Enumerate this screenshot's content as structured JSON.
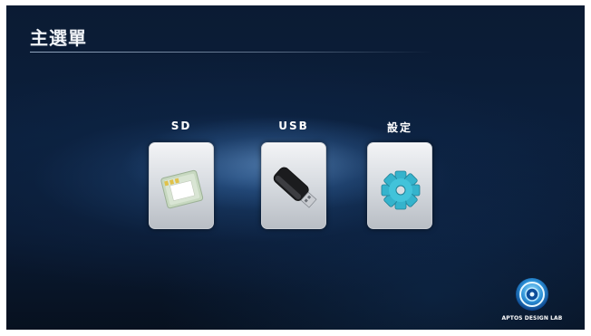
{
  "header": {
    "title": "主選單"
  },
  "menu": {
    "items": [
      {
        "label": "SD",
        "icon": "sd-card-icon"
      },
      {
        "label": "USB",
        "icon": "usb-drive-icon"
      },
      {
        "label": "設定",
        "icon": "gear-icon"
      }
    ]
  },
  "brand": {
    "name": "APTOS DESIGN LAB",
    "logo": "aptos-logo-icon"
  },
  "colors": {
    "background": "#0b1f3c",
    "tile": "#d9dde2",
    "accent_cyan": "#3fb8d0",
    "text": "#ffffff"
  }
}
